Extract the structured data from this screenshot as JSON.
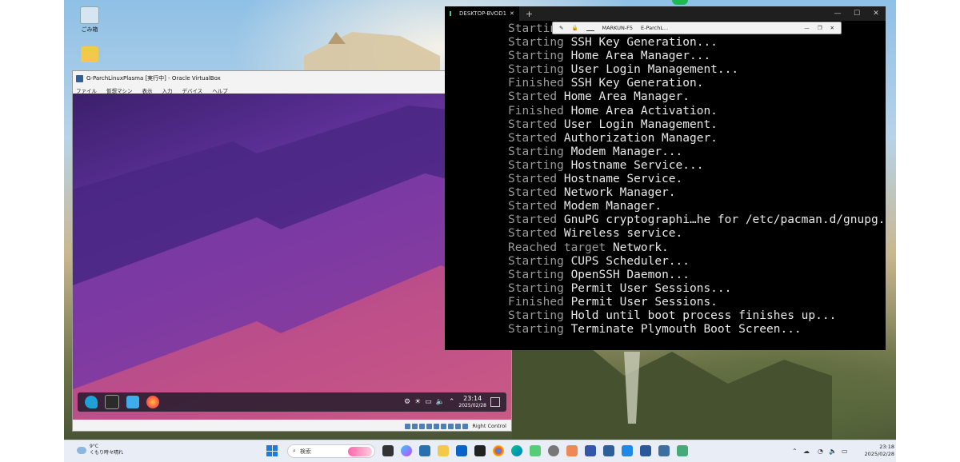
{
  "desktop": {
    "icons": [
      {
        "label": "ごみ箱",
        "icon": "recycle-bin-icon"
      },
      {
        "label": "",
        "icon": "folder-icon"
      }
    ]
  },
  "vbox": {
    "title": "G-ParchLinuxPlasma [実行中] - Oracle VirtualBox",
    "menu": [
      "ファイル",
      "仮想マシン",
      "表示",
      "入力",
      "デバイス",
      "ヘルプ"
    ],
    "guest_clock": {
      "time": "23:14",
      "date": "2025/02/28"
    },
    "panel_icons": [
      "app-launcher-icon",
      "terminal-icon",
      "file-manager-icon",
      "firefox-icon"
    ],
    "host_key": "Right Control"
  },
  "terminal": {
    "tab_title": "DESKTOP-BVOD1",
    "new_tab": "+",
    "lines": [
      {
        "status": "Starting",
        "text": ""
      },
      {
        "status": "Starting",
        "text": "SSH Key Generation..."
      },
      {
        "status": "Starting",
        "text": "Home Area Manager..."
      },
      {
        "status": "Starting",
        "text": "User Login Management..."
      },
      {
        "status": "Finished",
        "text": "SSH Key Generation."
      },
      {
        "status": "Started",
        "text": "Home Area Manager."
      },
      {
        "status": "Finished",
        "text": "Home Area Activation."
      },
      {
        "status": "Started",
        "text": "User Login Management."
      },
      {
        "status": "Started",
        "text": "Authorization Manager."
      },
      {
        "status": "Starting",
        "text": "Modem Manager..."
      },
      {
        "status": "Starting",
        "text": "Hostname Service..."
      },
      {
        "status": "Started",
        "text": "Hostname Service."
      },
      {
        "status": "Started",
        "text": "Network Manager."
      },
      {
        "status": "Started",
        "text": "Modem Manager."
      },
      {
        "status": "Started",
        "text": "GnuPG cryptographi…he for /etc/pacman.d/gnupg."
      },
      {
        "status": "Started",
        "text": "Wireless service."
      },
      {
        "status": "Reached target",
        "text": "Network."
      },
      {
        "status": "Starting",
        "text": "CUPS Scheduler..."
      },
      {
        "status": "Starting",
        "text": "OpenSSH Daemon..."
      },
      {
        "status": "Starting",
        "text": "Permit User Sessions..."
      },
      {
        "status": "Finished",
        "text": "Permit User Sessions."
      },
      {
        "status": "Starting",
        "text": "Hold until boot process finishes up..."
      },
      {
        "status": "Starting",
        "text": "Terminate Plymouth Boot Screen..."
      }
    ]
  },
  "rdp_bar": {
    "host": "MARKUN-F5",
    "connection": "E-ParchL..."
  },
  "taskbar": {
    "weather": {
      "temp": "9°C",
      "desc": "くもり時々晴れ"
    },
    "search_placeholder": "検索",
    "clock": {
      "time": "23:18",
      "date": "2025/02/28"
    },
    "accent": "#1f7ae0"
  }
}
